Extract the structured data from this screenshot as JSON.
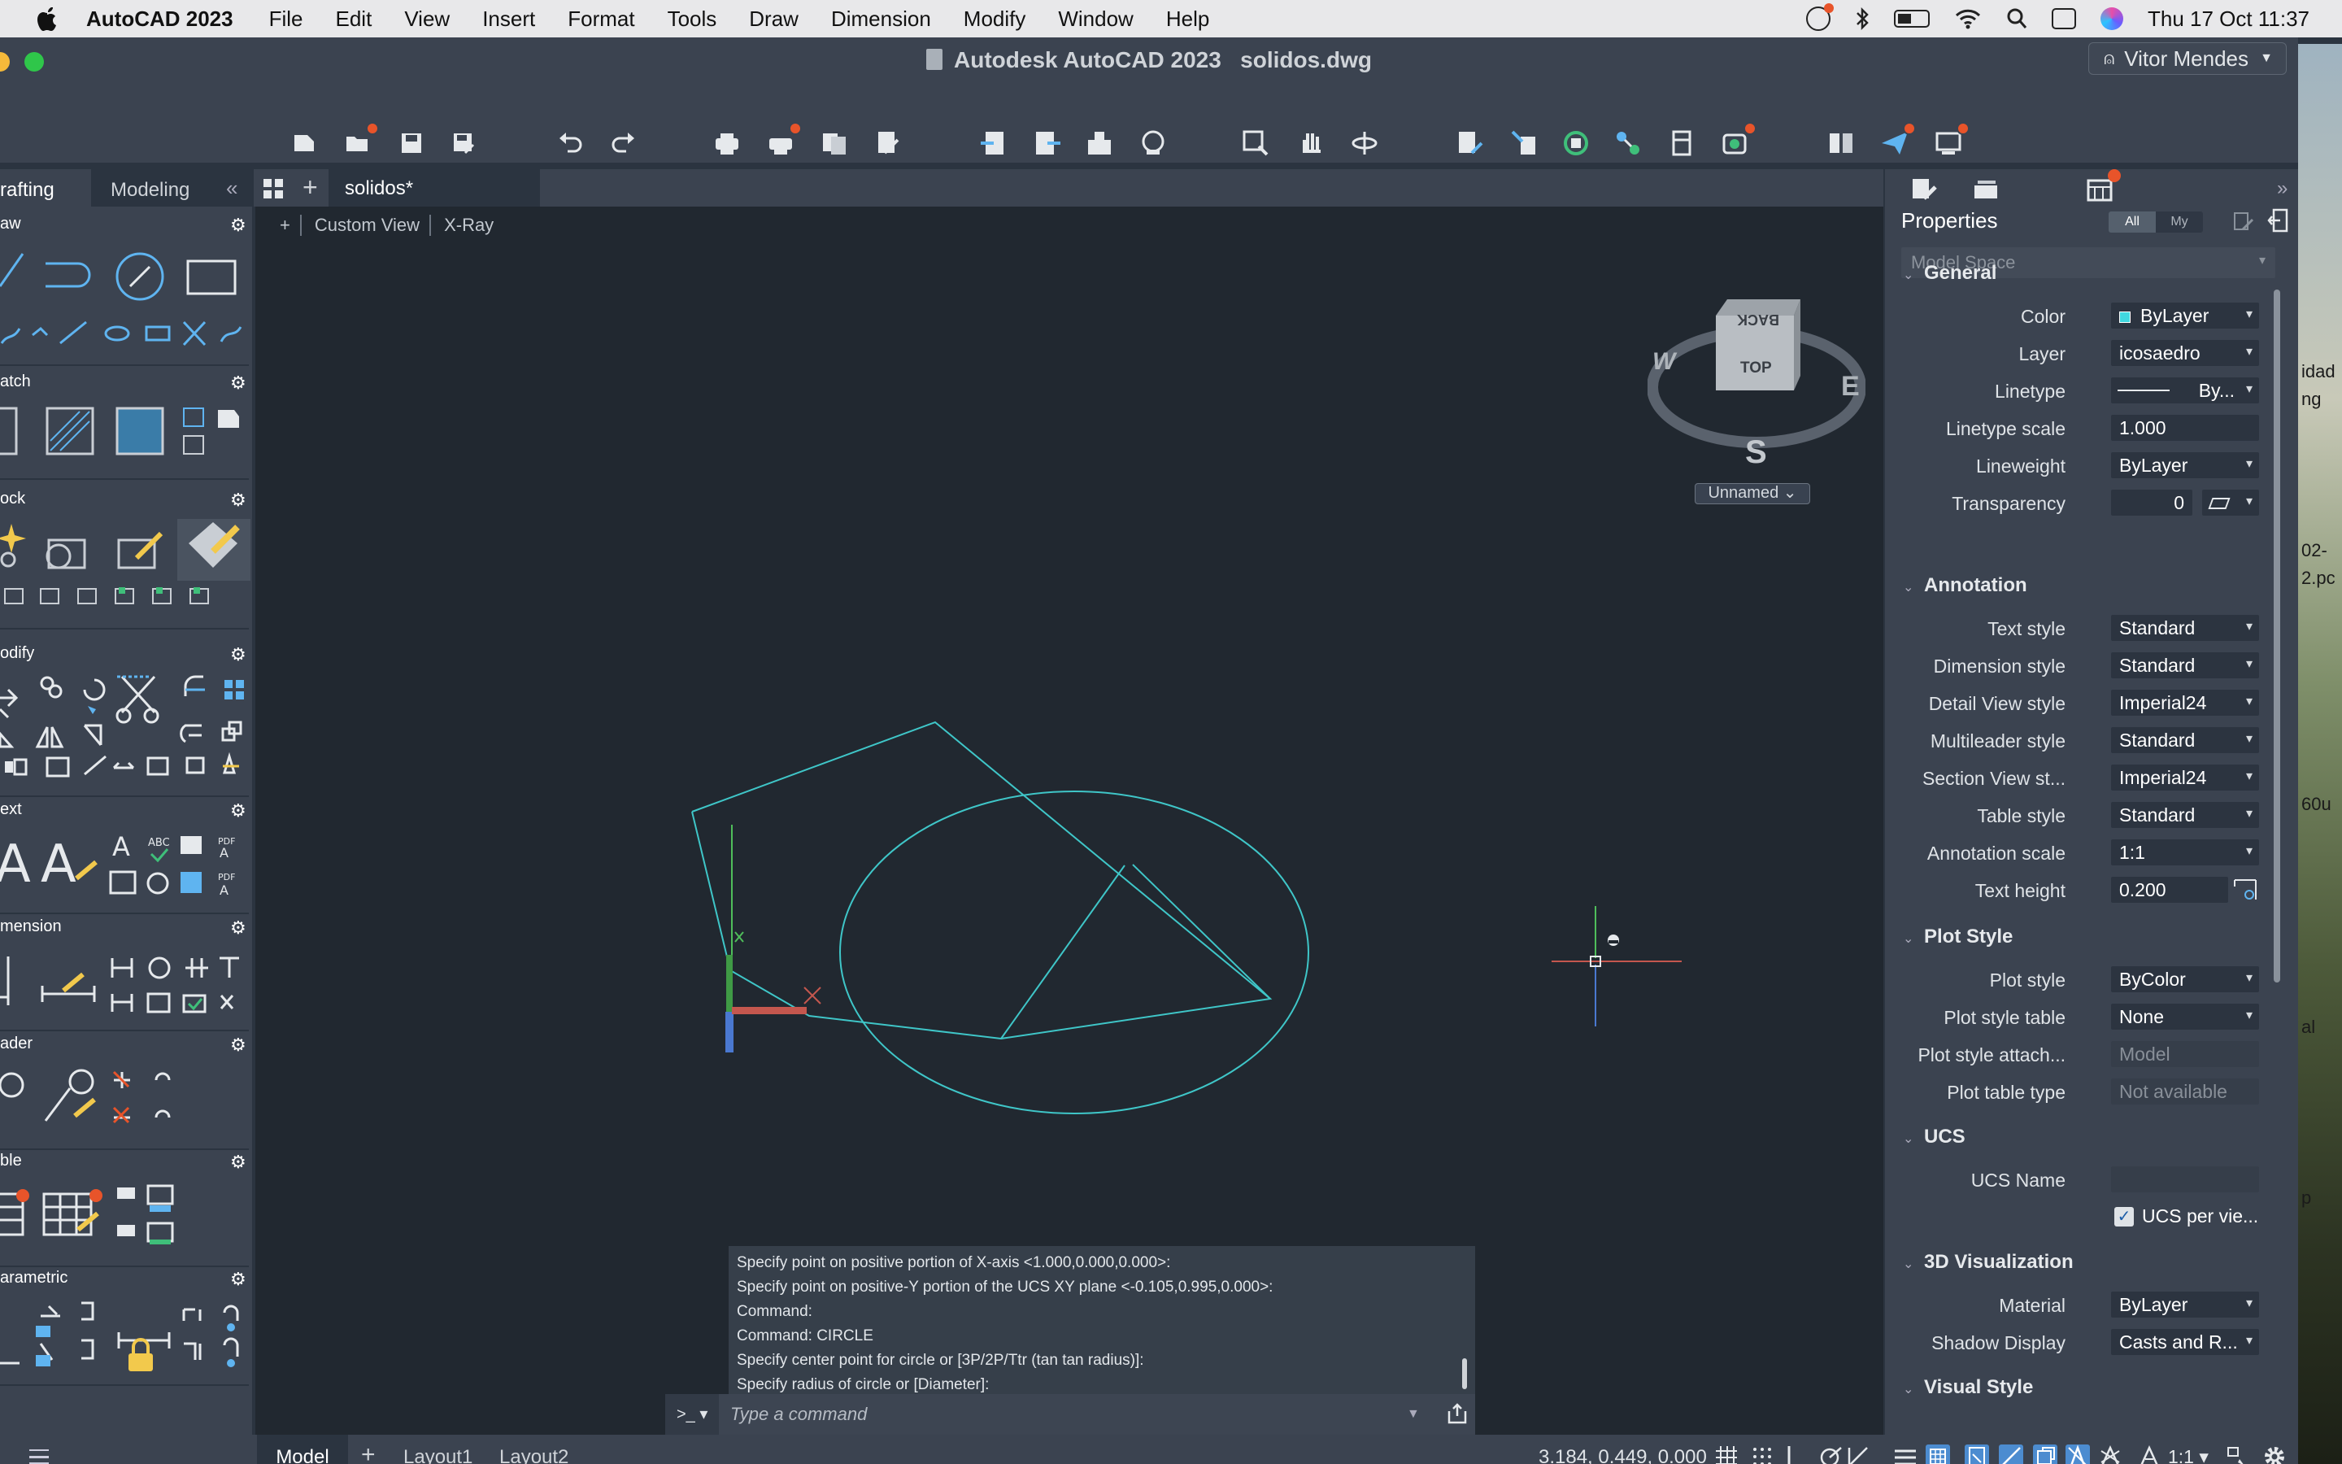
{
  "menubar": {
    "app_name": "AutoCAD 2023",
    "items": [
      "File",
      "Edit",
      "View",
      "Insert",
      "Format",
      "Tools",
      "Draw",
      "Dimension",
      "Modify",
      "Window",
      "Help"
    ],
    "datetime": "Thu 17 Oct  11:37"
  },
  "window": {
    "title": "Autodesk AutoCAD 2023",
    "filename": "solidos.dwg",
    "user": "Vitor Mendes"
  },
  "palette": {
    "tab_active": "rafting",
    "tab_other": "Modeling",
    "sections": [
      "aw",
      "atch",
      "ock",
      "odify",
      "ext",
      "mension",
      "ader",
      "ble",
      "arametric"
    ]
  },
  "doc_tab": "solidos*",
  "viewport": {
    "plus": "+",
    "view": "Custom View",
    "style": "X-Ray",
    "viewcube": {
      "back": "BACK",
      "top": "TOP",
      "w": "W",
      "e": "E",
      "s": "S"
    },
    "unnamed": "Unnamed"
  },
  "command": {
    "history": [
      "Specify point on positive portion of X-axis <1.000,0.000,0.000>:",
      "Specify point on positive-Y portion of the UCS XY plane <-0.105,0.995,0.000>:",
      "Command:",
      "Command: CIRCLE",
      "Specify center point for circle or [3P/2P/Ttr (tan tan radius)]:",
      "Specify radius of circle or [Diameter]:"
    ],
    "prompt": ">_",
    "placeholder": "Type a command"
  },
  "statusbar": {
    "tabs": [
      "Model",
      "Layout1",
      "Layout2"
    ],
    "coords": "3.184, 0.449, 0.000",
    "scale": "1:1"
  },
  "properties": {
    "title": "Properties",
    "filter_all": "All",
    "filter_my": "My",
    "space": "Model Space",
    "general": {
      "title": "General",
      "color_label": "Color",
      "color": "ByLayer",
      "layer_label": "Layer",
      "layer": "icosaedro",
      "linetype_label": "Linetype",
      "linetype": "By...",
      "linetype_scale_label": "Linetype scale",
      "linetype_scale": "1.000",
      "lineweight_label": "Lineweight",
      "lineweight": "ByLayer",
      "transparency_label": "Transparency",
      "transparency": "0"
    },
    "annotation": {
      "title": "Annotation",
      "text_style_label": "Text style",
      "text_style": "Standard",
      "dim_style_label": "Dimension style",
      "dim_style": "Standard",
      "detail_style_label": "Detail View style",
      "detail_style": "Imperial24",
      "mleader_style_label": "Multileader style",
      "mleader_style": "Standard",
      "section_style_label": "Section View st...",
      "section_style": "Imperial24",
      "table_style_label": "Table style",
      "table_style": "Standard",
      "anno_scale_label": "Annotation scale",
      "anno_scale": "1:1",
      "text_height_label": "Text height",
      "text_height": "0.200"
    },
    "plot": {
      "title": "Plot Style",
      "plot_style_label": "Plot style",
      "plot_style": "ByColor",
      "plot_table_label": "Plot style table",
      "plot_table": "None",
      "plot_attach_label": "Plot style attach...",
      "plot_attach": "Model",
      "plot_type_label": "Plot table type",
      "plot_type": "Not available"
    },
    "ucs": {
      "title": "UCS",
      "name_label": "UCS Name",
      "name": "",
      "per_view": "UCS per vie..."
    },
    "vis3d": {
      "title": "3D Visualization",
      "material_label": "Material",
      "material": "ByLayer",
      "shadow_label": "Shadow Display",
      "shadow": "Casts and R..."
    },
    "visual_style": {
      "title": "Visual Style"
    }
  },
  "desktop_text": [
    "idad",
    "ng",
    "02-",
    "2.pc",
    "60u",
    "al",
    "p"
  ],
  "colors": {
    "accent": "#5fb4f0",
    "notify": "#e8542a",
    "geometry": "#3fc6c8"
  }
}
